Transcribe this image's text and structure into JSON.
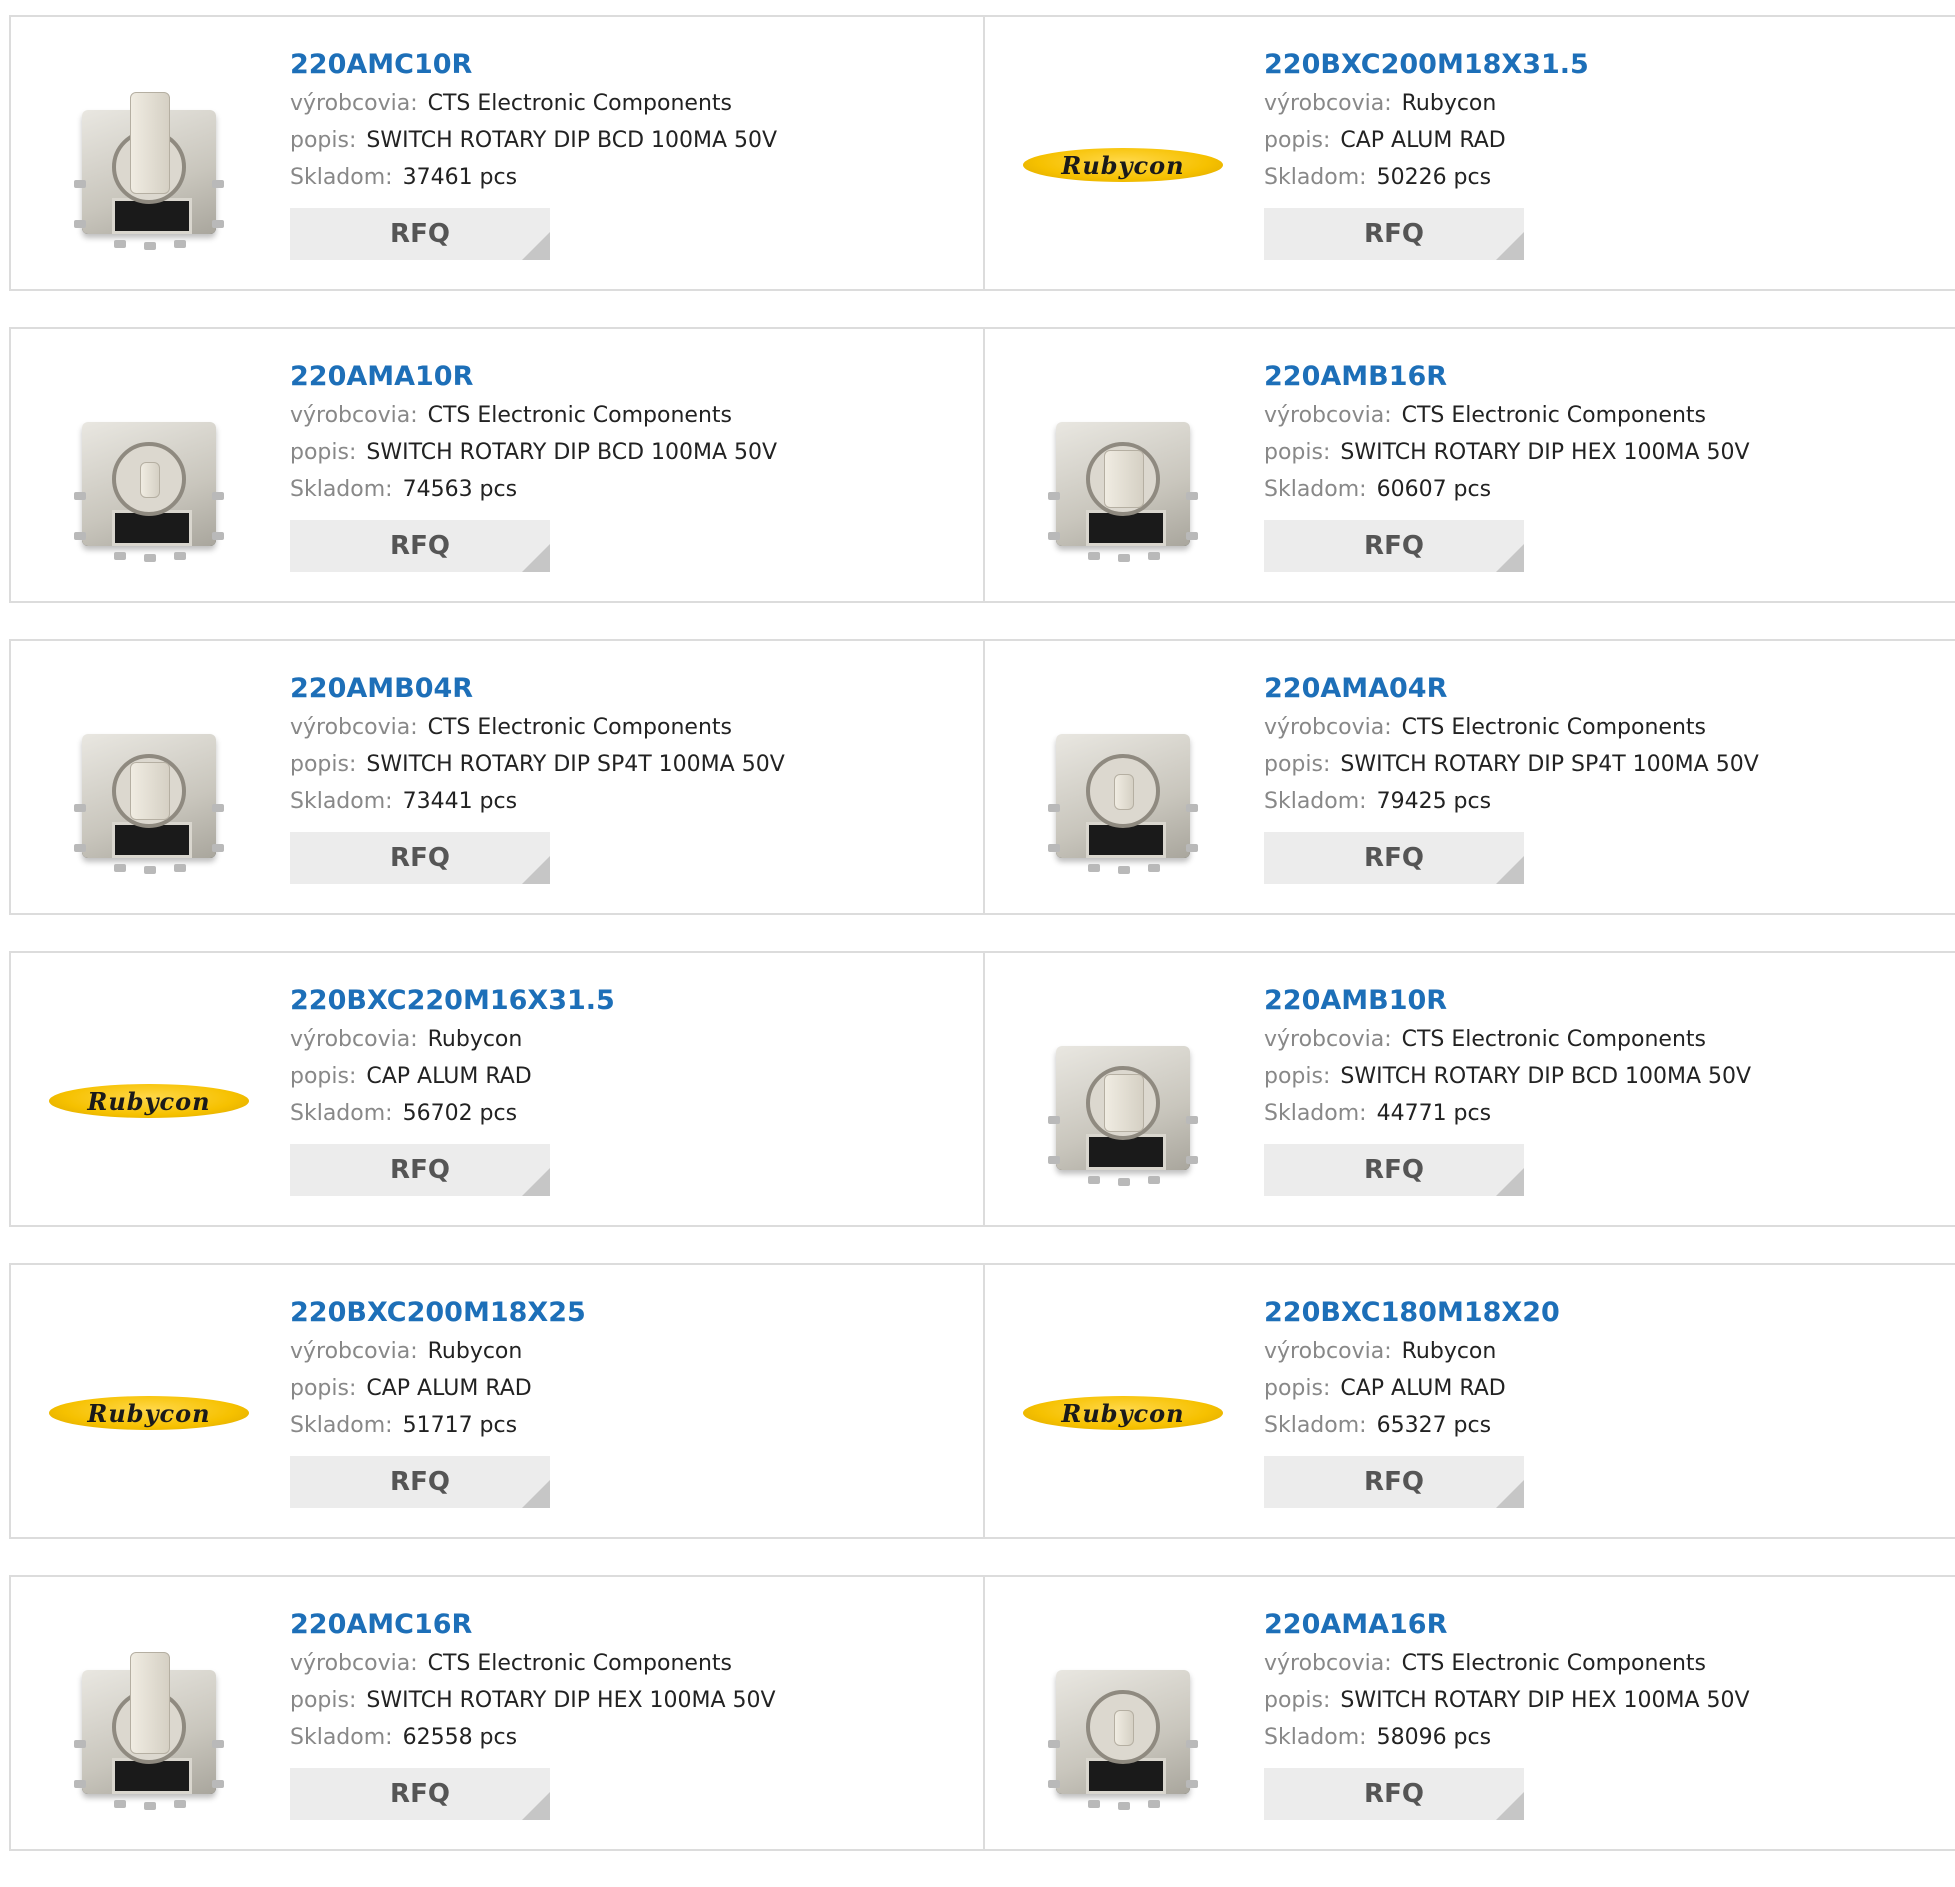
{
  "labels": {
    "manufacturer": "výrobcovia:",
    "description": "popis:",
    "stock": "Skladom:",
    "rfq": "RFQ"
  },
  "colors": {
    "part_link": "#1d6fb8",
    "label": "#888888",
    "rfq_bg": "#ececec"
  },
  "products": [
    {
      "part": "220AMC10R",
      "manufacturer": "CTS Electronic Components",
      "description": "SWITCH ROTARY DIP BCD 100MA 50V",
      "stock": "37461 pcs",
      "image": "rotary-switch-tall-knob"
    },
    {
      "part": "220BXC200M18X31.5",
      "manufacturer": "Rubycon",
      "description": "CAP ALUM RAD",
      "stock": "50226 pcs",
      "image": "rubycon-logo",
      "logo_text": "Rubycon"
    },
    {
      "part": "220AMA10R",
      "manufacturer": "CTS Electronic Components",
      "description": "SWITCH ROTARY DIP BCD 100MA 50V",
      "stock": "74563 pcs",
      "image": "rotary-switch-slot"
    },
    {
      "part": "220AMB16R",
      "manufacturer": "CTS Electronic Components",
      "description": "SWITCH ROTARY DIP HEX 100MA 50V",
      "stock": "60607 pcs",
      "image": "rotary-switch-knob"
    },
    {
      "part": "220AMB04R",
      "manufacturer": "CTS Electronic Components",
      "description": "SWITCH ROTARY DIP SP4T 100MA 50V",
      "stock": "73441 pcs",
      "image": "rotary-switch-knob"
    },
    {
      "part": "220AMA04R",
      "manufacturer": "CTS Electronic Components",
      "description": "SWITCH ROTARY DIP SP4T 100MA 50V",
      "stock": "79425 pcs",
      "image": "rotary-switch-slot"
    },
    {
      "part": "220BXC220M16X31.5",
      "manufacturer": "Rubycon",
      "description": "CAP ALUM RAD",
      "stock": "56702 pcs",
      "image": "rubycon-logo",
      "logo_text": "Rubycon"
    },
    {
      "part": "220AMB10R",
      "manufacturer": "CTS Electronic Components",
      "description": "SWITCH ROTARY DIP BCD 100MA 50V",
      "stock": "44771 pcs",
      "image": "rotary-switch-knob"
    },
    {
      "part": "220BXC200M18X25",
      "manufacturer": "Rubycon",
      "description": "CAP ALUM RAD",
      "stock": "51717 pcs",
      "image": "rubycon-logo",
      "logo_text": "Rubycon"
    },
    {
      "part": "220BXC180M18X20",
      "manufacturer": "Rubycon",
      "description": "CAP ALUM RAD",
      "stock": "65327 pcs",
      "image": "rubycon-logo",
      "logo_text": "Rubycon"
    },
    {
      "part": "220AMC16R",
      "manufacturer": "CTS Electronic Components",
      "description": "SWITCH ROTARY DIP HEX 100MA 50V",
      "stock": "62558 pcs",
      "image": "rotary-switch-tall-knob"
    },
    {
      "part": "220AMA16R",
      "manufacturer": "CTS Electronic Components",
      "description": "SWITCH ROTARY DIP HEX 100MA 50V",
      "stock": "58096 pcs",
      "image": "rotary-switch-slot"
    }
  ]
}
